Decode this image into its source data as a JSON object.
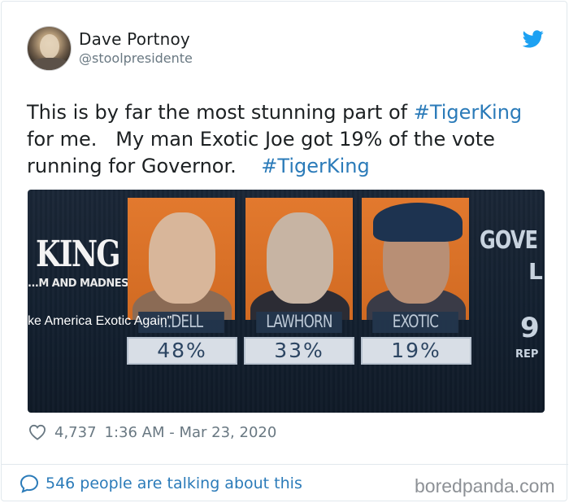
{
  "tweet": {
    "author": {
      "display_name": "Dave Portnoy",
      "handle": "@stoolpresidente",
      "avatar_icon": "profile-photo"
    },
    "brand_icon": "twitter-bird-icon",
    "brand_color": "#1da1f2",
    "text": {
      "line1_prefix": "This is by far the most stunning part of ",
      "hashtag1": "#TigerKing",
      "line2": "for me.   My man Exotic Joe got 19% of the vote",
      "line3_prefix": "running for Governor.    ",
      "hashtag2": "#TigerKing"
    },
    "hashtag_color": "#2b7bb9",
    "media": {
      "show_logo": "KING",
      "show_subtitle": "...M AND MADNESS",
      "caption": "ke America Exotic Again\"",
      "candidates": [
        {
          "name": "...DELL",
          "percent": "48%"
        },
        {
          "name": "LAWHORN",
          "percent": "33%"
        },
        {
          "name": "EXOTIC",
          "percent": "19%"
        }
      ],
      "right_panel": {
        "title": "GOVE",
        "subtitle": "L",
        "number": "9",
        "label": "REP"
      }
    },
    "likes": "4,737",
    "timestamp": "1:36 AM - Mar 23, 2020",
    "talking": "546 people are talking about this"
  },
  "watermark": "boredpanda.com"
}
